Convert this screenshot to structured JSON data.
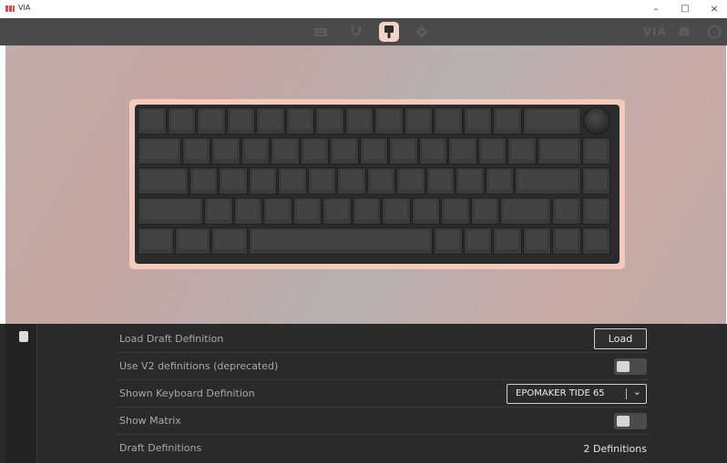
{
  "app": {
    "title": "VIA"
  },
  "window_controls": {
    "minimize": "–",
    "maximize": "□",
    "close": "×"
  },
  "nav": {
    "tabs": [
      {
        "icon": "keyboard-icon",
        "active": false
      },
      {
        "icon": "test-key-icon",
        "active": false
      },
      {
        "icon": "design-icon",
        "active": true
      },
      {
        "icon": "settings-icon",
        "active": false
      }
    ],
    "right_icons": [
      "via-logo",
      "discord-icon",
      "github-icon"
    ],
    "brand": "VIA"
  },
  "settings": {
    "rows": [
      {
        "label": "Load Draft Definition",
        "control": "button",
        "button_label": "Load"
      },
      {
        "label": "Use V2 definitions (deprecated)",
        "control": "toggle",
        "on": false
      },
      {
        "label": "Shown Keyboard Definition",
        "control": "select",
        "value": "EPOMAKER TIDE 65",
        "chevron": "⌄"
      },
      {
        "label": "Show Matrix",
        "control": "toggle",
        "on": false
      },
      {
        "label": "Draft Definitions",
        "control": "text",
        "value": "2 Definitions"
      }
    ]
  },
  "colors": {
    "frame": "#f2cbbd",
    "nav_bg": "#4a4a4b",
    "panel_bg": "#2a2a2a",
    "accent": "#f3d2c8"
  }
}
